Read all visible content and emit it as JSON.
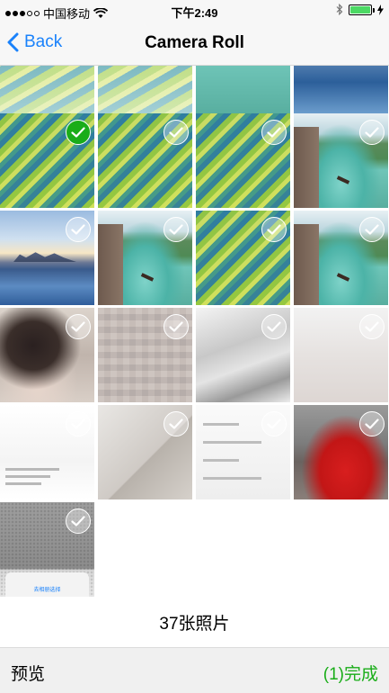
{
  "status_bar": {
    "carrier": "中国移动",
    "time": "下午2:49",
    "battery_level": 1.0,
    "battery_color": "#4cd964"
  },
  "nav": {
    "back_label": "Back",
    "title": "Camera Roll"
  },
  "grid": {
    "selected_index": 4,
    "photos": [
      {
        "style": "terrace-top"
      },
      {
        "style": "terrace-top"
      },
      {
        "style": "river-top"
      },
      {
        "style": "lake-top"
      },
      {
        "style": "terrace"
      },
      {
        "style": "terrace"
      },
      {
        "style": "terrace"
      },
      {
        "style": "river"
      },
      {
        "style": "lake"
      },
      {
        "style": "river"
      },
      {
        "style": "terrace"
      },
      {
        "style": "river"
      },
      {
        "style": "face"
      },
      {
        "style": "blur1"
      },
      {
        "style": "blur2"
      },
      {
        "style": "blur3"
      },
      {
        "style": "doc"
      },
      {
        "style": "wall"
      },
      {
        "style": "screen"
      },
      {
        "style": "red"
      },
      {
        "style": "gray"
      }
    ],
    "gray_sheet_text": "去相册选择"
  },
  "footer": {
    "photo_count_label": "37张照片"
  },
  "toolbar": {
    "preview_label": "预览",
    "done_label": "(1)完成",
    "done_color": "#1aad19"
  },
  "colors": {
    "accent_blue": "#1a82fb",
    "selected_green": "#1aad19"
  }
}
